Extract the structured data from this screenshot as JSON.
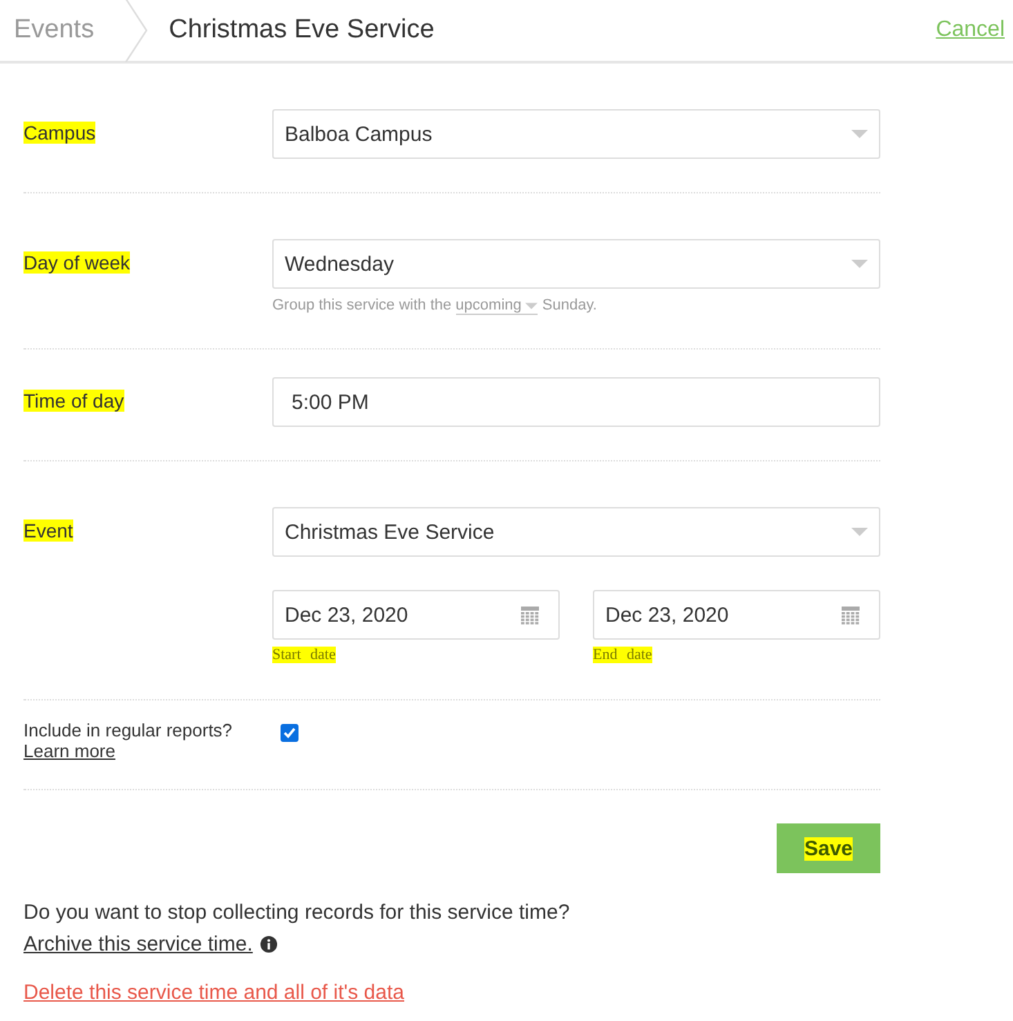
{
  "header": {
    "breadcrumb": "Events",
    "title": "Christmas Eve Service",
    "cancel": "Cancel"
  },
  "fields": [
    {
      "kind": "select",
      "label": "Campus",
      "highlighted": true,
      "value": "Balboa Campus"
    },
    {
      "kind": "select",
      "label": "Day of week",
      "highlighted": true,
      "value": "Wednesday",
      "hint": {
        "before": "Group this service with the",
        "choice": "upcoming",
        "after": "Sunday."
      }
    },
    {
      "kind": "text",
      "label": "Time of day",
      "highlighted": true,
      "value": "5:00 PM"
    },
    {
      "kind": "event",
      "label": "Event",
      "highlighted": true,
      "value": "Christmas Eve Service",
      "dates": [
        {
          "value": "Dec 23, 2020",
          "caption": "Start date",
          "highlighted": true
        },
        {
          "value": "Dec 23, 2020",
          "caption": "End date",
          "highlighted": true
        }
      ]
    },
    {
      "kind": "checkbox",
      "label": "Include in regular reports?",
      "link": "Learn more",
      "checked": true,
      "highlighted": false
    }
  ],
  "save": {
    "label": "Save",
    "highlighted": true
  },
  "archive": {
    "question": "Do you want to stop collecting records for this service time?",
    "link": "Archive this service time."
  },
  "delete": "Delete this service time and all of it's data"
}
